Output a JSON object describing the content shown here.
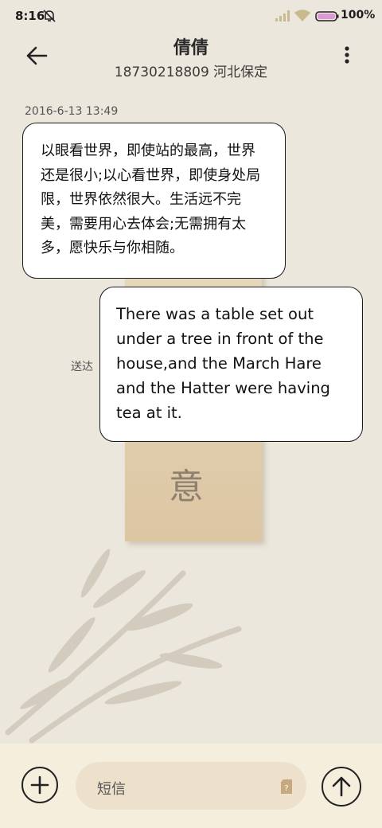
{
  "status_bar": {
    "time": "8:16",
    "battery": "100%",
    "icons": [
      "bell-mute-icon",
      "signal-icon",
      "wifi-icon",
      "battery-icon"
    ]
  },
  "header": {
    "title": "倩倩",
    "subtitle": "18730218809 河北保定",
    "back_icon": "back-arrow-icon",
    "menu_icon": "more-vert-icon"
  },
  "conversation": {
    "timestamp": "2016-6-13 13:49",
    "messages": [
      {
        "direction": "incoming",
        "text": "以眼看世界，即使站的最高，世界还是很小;以心看世界，即使身处局限，世界依然很大。生活远不完美，需要用心去体会;无需拥有太多，愿快乐与你相随。"
      },
      {
        "direction": "outgoing",
        "text": "There was a table set out under a tree in front of the house,and the March Hare and the Hatter were having tea at it.",
        "status": "送达"
      }
    ]
  },
  "composer": {
    "placeholder": "短信",
    "add_icon": "plus-icon",
    "sim_icon": "sim-icon",
    "send_icon": "send-arrow-icon"
  },
  "wallpaper": {
    "card_glyph": "意"
  }
}
